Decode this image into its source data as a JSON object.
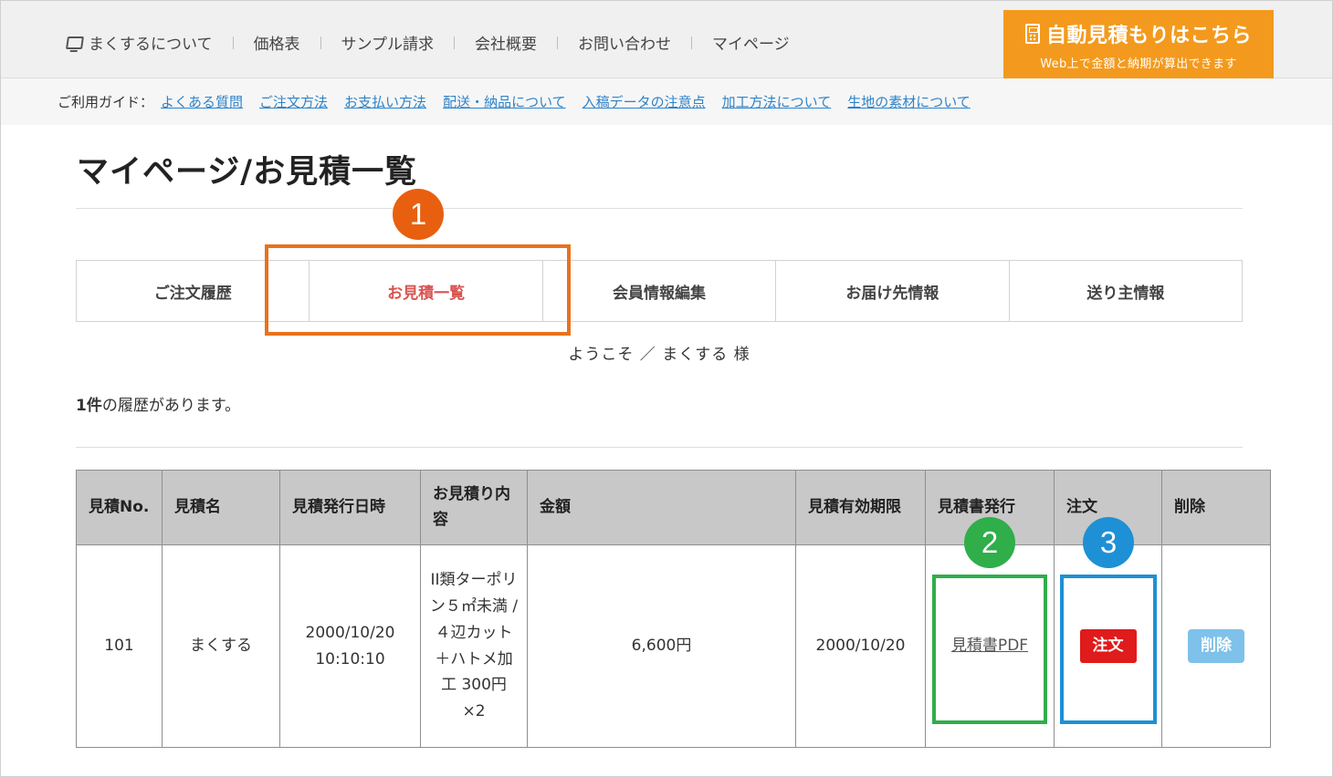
{
  "header": {
    "nav": [
      {
        "label": "まくするについて",
        "icon": "logo-icon"
      },
      {
        "label": "価格表"
      },
      {
        "label": "サンプル請求"
      },
      {
        "label": "会社概要"
      },
      {
        "label": "お問い合わせ"
      },
      {
        "label": "マイページ"
      }
    ],
    "cta": {
      "label": "自動見積もりはこちら",
      "sub": "Web上で金額と納期が算出できます",
      "icon": "calculator-icon",
      "color": "#f39a1e"
    }
  },
  "guide": {
    "label": "ご利用ガイド：",
    "links": [
      "よくある質問",
      "ご注文方法",
      "お支払い方法",
      "配送・納品について",
      "入稿データの注意点",
      "加工方法について",
      "生地の素材について"
    ]
  },
  "page": {
    "title": "マイページ/お見積一覧",
    "welcome": "ようこそ ／ まくする 様",
    "count_number": "1件",
    "count_text": "の履歴があります。"
  },
  "tabs": [
    {
      "label": "ご注文履歴",
      "active": false
    },
    {
      "label": "お見積一覧",
      "active": true
    },
    {
      "label": "会員情報編集",
      "active": false
    },
    {
      "label": "お届け先情報",
      "active": false
    },
    {
      "label": "送り主情報",
      "active": false
    }
  ],
  "annotations": {
    "badge_1": "1",
    "badge_2": "2",
    "badge_3": "3",
    "colors": {
      "orange": "#e8721d",
      "green": "#2fae4a",
      "blue": "#1e90d6"
    }
  },
  "table": {
    "headers": [
      "見積No.",
      "見積名",
      "見積発行日時",
      "お見積り内容",
      "金額",
      "見積有効期限",
      "見積書発行",
      "注文",
      "削除"
    ],
    "rows": [
      {
        "no": "101",
        "name": "まくする",
        "issued": "2000/10/20 10:10:10",
        "content": "II類ターポリン５㎡未満 / ４辺カット＋ハトメ加工 300円 ×2",
        "amount": "6,600円",
        "expires": "2000/10/20",
        "pdf_label": "見積書PDF",
        "order_label": "注文",
        "delete_label": "削除"
      }
    ]
  }
}
